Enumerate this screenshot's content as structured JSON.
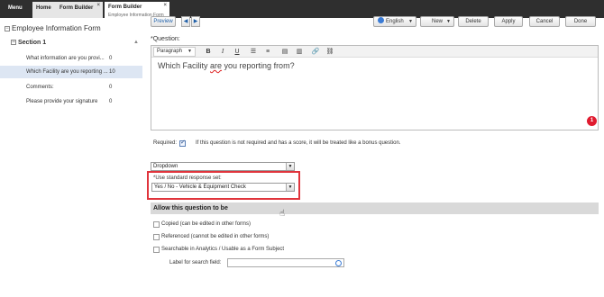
{
  "tabs": {
    "menu": "Menu",
    "home": "Home",
    "form_builder_1": "Form Builder",
    "form_builder_2": "Form Builder",
    "form_builder_2_sub": "Employee Information Form"
  },
  "tree": {
    "form_title": "Employee Information Form",
    "section": "Section 1",
    "questions": [
      {
        "text": "What information are you provi...",
        "count": "0"
      },
      {
        "text": "Which Facility are you reporting ...",
        "count": "10"
      },
      {
        "text": "Comments:",
        "count": "0"
      },
      {
        "text": "Please provide your signature",
        "count": "0"
      }
    ]
  },
  "toolbar": {
    "preview": "Preview",
    "language": "English",
    "new": "New",
    "delete": "Delete",
    "apply": "Apply",
    "cancel": "Cancel",
    "done": "Done"
  },
  "question": {
    "label": "*Question:",
    "paragraph": "Paragraph",
    "text_before": "Which Facility ",
    "text_are": "are",
    "text_after": " you reporting from?",
    "error_count": "1"
  },
  "required": {
    "label": "Required:",
    "checked": true,
    "note": "If this question is not required and has a score, it will be treated like a bonus question."
  },
  "response_type": "Dropdown",
  "standard_response": {
    "label": "*Use standard response set:",
    "value": "Yes / No - Vehicle & Equipment Check"
  },
  "allow": {
    "header": "Allow this question to be",
    "options": [
      "Copied (can be edited in other forms)",
      "Referenced (cannot be edited in other forms)",
      "Searchable in Analytics / Usable as a Form Subject"
    ],
    "search_label": "Label for search field:"
  },
  "colors": {
    "accent": "#1f5fa8",
    "highlight": "#e0343c",
    "badge": "#e01b2f",
    "selected_row": "#dde6f3"
  }
}
